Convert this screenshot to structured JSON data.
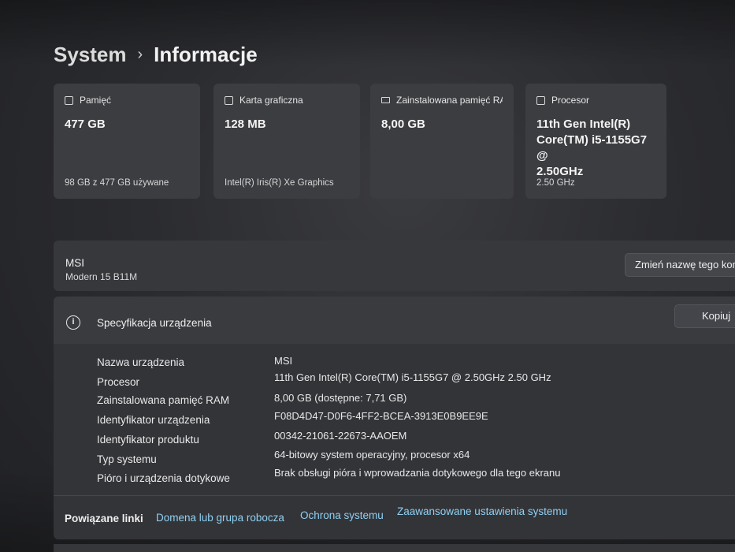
{
  "breadcrumb": {
    "root": "System",
    "current": "Informacje"
  },
  "cards": [
    {
      "icon": "storage-icon",
      "label": "Pamięć",
      "value": "477 GB",
      "sub": "98 GB z 477 GB używane"
    },
    {
      "icon": "display-icon",
      "label": "Karta graficzna",
      "value": "128 MB",
      "sub": "Intel(R) Iris(R) Xe Graphics"
    },
    {
      "icon": "ram-icon",
      "label": "Zainstalowana pamięć RAM",
      "value": "8,00 GB",
      "sub": ""
    },
    {
      "icon": "processor-icon",
      "label": "Procesor",
      "value_lines": [
        "11th Gen Intel(R)",
        "Core(TM) i5-1155G7 @",
        "2.50GHz"
      ],
      "sub": "2.50 GHz"
    }
  ],
  "device": {
    "name": "MSI",
    "model": "Modern 15 B11M",
    "rename_label": "Zmień nazwę tego kom"
  },
  "spec": {
    "title": "Specyfikacja urządzenia",
    "copy_label": "Kopiuj",
    "rows": [
      {
        "label": "Nazwa urządzenia",
        "value": "MSI"
      },
      {
        "label": "Procesor",
        "value": "11th Gen Intel(R) Core(TM) i5-1155G7 @ 2.50GHz   2.50 GHz"
      },
      {
        "label": "Zainstalowana pamięć RAM",
        "value": "8,00 GB (dostępne: 7,71 GB)"
      },
      {
        "label": "Identyfikator urządzenia",
        "value": "F08D4D47-D0F6-4FF2-BCEA-3913E0B9EE9E"
      },
      {
        "label": "Identyfikator produktu",
        "value": "00342-21061-22673-AAOEM"
      },
      {
        "label": "Typ systemu",
        "value": "64-bitowy system operacyjny, procesor x64"
      },
      {
        "label": "Pióro i urządzenia dotykowe",
        "value": "Brak obsługi pióra i wprowadzania dotykowego dla tego ekranu"
      }
    ]
  },
  "links": {
    "label": "Powiązane linki",
    "items": [
      "Domena lub grupa robocza",
      "Ochrona systemu",
      "Zaawansowane ustawienia systemu"
    ]
  },
  "colors": {
    "link": "#8fd0f2",
    "card_bg": "#3c3d41",
    "panel_bg": "#333438"
  }
}
